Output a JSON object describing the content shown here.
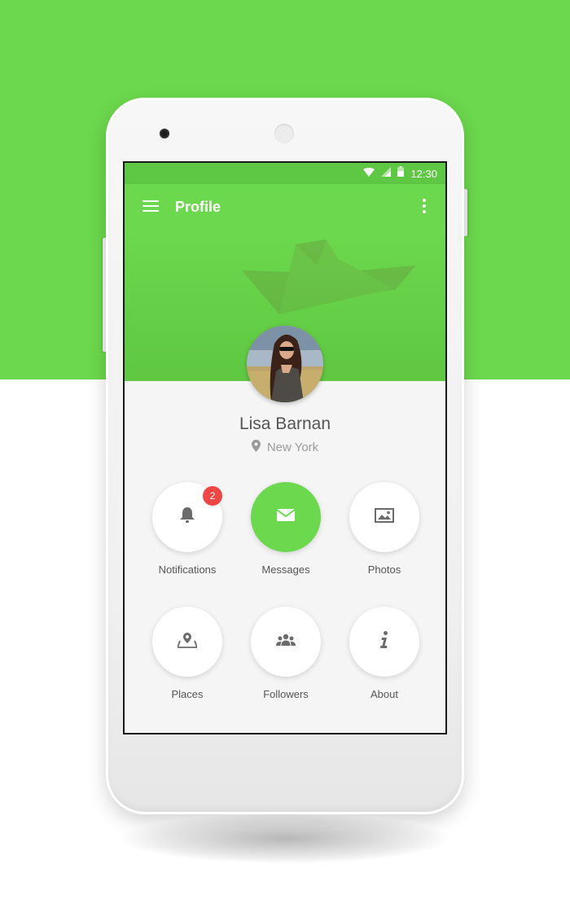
{
  "status_bar": {
    "time": "12:30",
    "icons": [
      "wifi-icon",
      "cell-signal-icon",
      "battery-icon"
    ]
  },
  "app_bar": {
    "title": "Profile",
    "menu_icon": "hamburger-menu-icon",
    "overflow_icon": "more-vert-icon"
  },
  "profile": {
    "name": "Lisa Barnan",
    "location": "New York",
    "location_icon": "location-pin-icon"
  },
  "menu": [
    {
      "label": "Notifications",
      "icon": "bell-icon",
      "badge": "2",
      "active": false
    },
    {
      "label": "Messages",
      "icon": "envelope-icon",
      "active": true
    },
    {
      "label": "Photos",
      "icon": "image-icon",
      "active": false
    },
    {
      "label": "Places",
      "icon": "map-pin-icon",
      "active": false
    },
    {
      "label": "Followers",
      "icon": "people-icon",
      "active": false
    },
    {
      "label": "About",
      "icon": "info-icon",
      "active": false
    }
  ],
  "colors": {
    "accent": "#6cd84d",
    "status_bar": "#5ec743",
    "badge": "#f04646",
    "text": "#555555",
    "muted": "#9a9a9a"
  }
}
